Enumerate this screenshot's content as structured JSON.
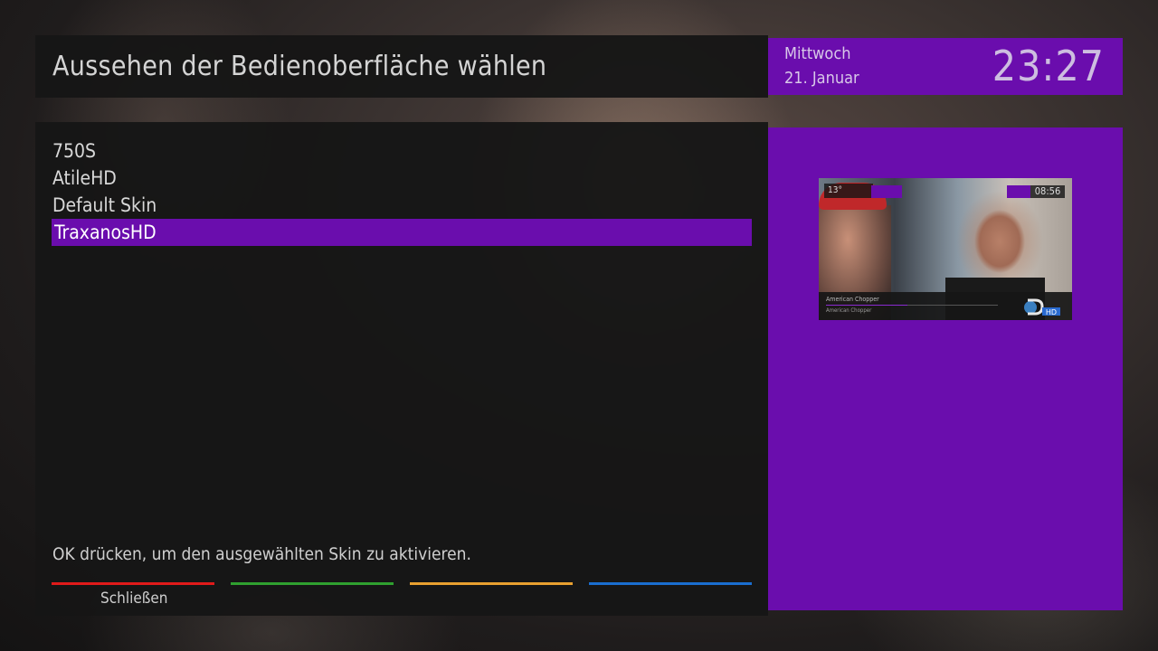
{
  "header": {
    "title": "Aussehen der Bedienoberfläche wählen"
  },
  "clock": {
    "day": "Mittwoch",
    "date": "21. Januar",
    "time": "23:27"
  },
  "skins": {
    "items": [
      "750S",
      "AtileHD",
      "Default Skin",
      "TraxanosHD"
    ],
    "selected": "TraxanosHD"
  },
  "hint": "OK drücken, um den ausgewählten Skin zu aktivieren.",
  "buttons": {
    "red_label": "Schließen"
  },
  "colors": {
    "accent": "#6a0dad",
    "red": "#e01a1a",
    "green": "#2fa02f",
    "yellow": "#e8a030",
    "blue": "#1a6ed0"
  },
  "preview": {
    "weather_temp": "13°",
    "time": "08:56",
    "program1": "American Chopper",
    "program2": "American Chopper",
    "channel_logo": "HD"
  }
}
